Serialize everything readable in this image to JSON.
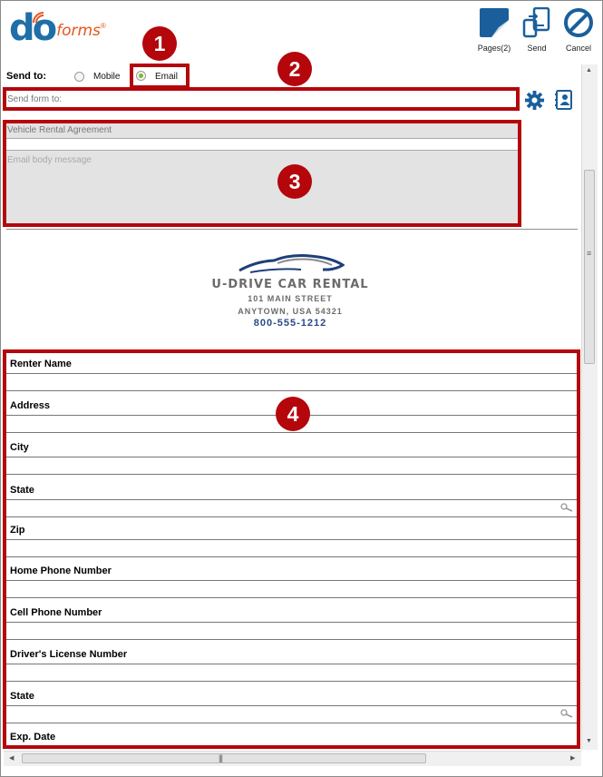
{
  "app": {
    "logo_do": "do",
    "logo_forms": "forms",
    "logo_reg": "®"
  },
  "toolbar": {
    "pages_label": "Pages(2)",
    "send_label": "Send",
    "cancel_label": "Cancel"
  },
  "send_to": {
    "label": "Send to:",
    "options": [
      {
        "label": "Mobile",
        "selected": false
      },
      {
        "label": "Email",
        "selected": true
      }
    ]
  },
  "email": {
    "recipient_placeholder": "Send form to:",
    "subject": "Vehicle Rental Agreement",
    "body_placeholder": "Email body message"
  },
  "company": {
    "name": "U-DRIVE CAR RENTAL",
    "street": "101 MAIN STREET",
    "city": "ANYTOWN, USA 54321",
    "phone": "800-555-1212"
  },
  "form_fields": [
    {
      "label": "Renter Name",
      "lookup": false
    },
    {
      "label": "Address",
      "lookup": false
    },
    {
      "label": "City",
      "lookup": false
    },
    {
      "label": "State",
      "lookup": true
    },
    {
      "label": "Zip",
      "lookup": false
    },
    {
      "label": "Home Phone Number",
      "lookup": false
    },
    {
      "label": "Cell Phone Number",
      "lookup": false
    },
    {
      "label": "Driver's License Number",
      "lookup": false
    },
    {
      "label": "State",
      "lookup": true
    },
    {
      "label": "Exp. Date",
      "lookup": false
    }
  ],
  "callouts": [
    "1",
    "2",
    "3",
    "4"
  ],
  "icons": {
    "settings": "gear-icon",
    "contacts": "address-book-icon",
    "lookup": "search-icon"
  },
  "colors": {
    "callout_red": "#b4060b",
    "brand_blue": "#1e6fa8",
    "brand_orange": "#e8541e",
    "toolbar_blue": "#1a5f9c",
    "radio_selected": "#7bbd2a"
  }
}
